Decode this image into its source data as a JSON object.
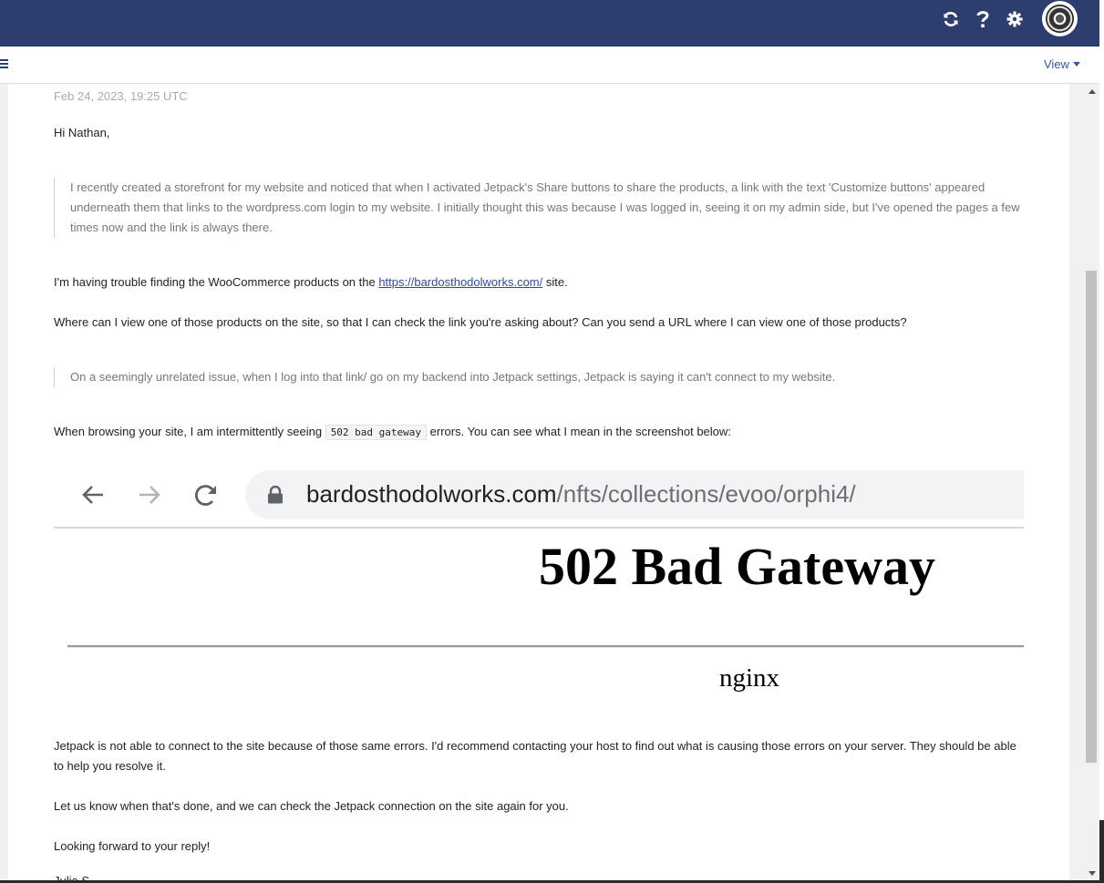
{
  "topbar": {
    "icons": [
      "refresh-icon",
      "help-icon",
      "gear-icon",
      "avatar"
    ],
    "bg_color": "#2d3e6e"
  },
  "subbar": {
    "view_label": "View"
  },
  "message": {
    "date": "Feb 24, 2023, 19:25 UTC",
    "greeting": "Hi Nathan,",
    "quote1": "I recently created a storefront for my website and noticed that when I activated Jetpack's Share buttons to share the products, a link with the text 'Customize buttons' appeared underneath them that links to the wordpress.com login to my website. I initially thought this was because I was logged in, seeing it on my admin side, but I've opened the pages a few times now and the link is always there.",
    "para1_before": "I'm having trouble finding the WooCommerce products on the ",
    "para1_link": "https://bardosthodolworks.com/",
    "para1_after": " site.",
    "para2": "Where can I view one of those products on the site, so that I can check the link you're asking about? Can you send a URL where I can view one of those products?",
    "quote2": "On a seemingly unrelated issue, when I log into that link/ go on my backend into Jetpack settings, Jetpack is saying it can't connect to my website.",
    "para3_before": "When browsing your site, I am intermittently seeing ",
    "para3_code": "502 bad gateway",
    "para3_after": " errors. You can see what I mean in the screenshot below:",
    "para4": "Jetpack is not able to connect to the site because of those same errors. I'd recommend contacting your host to find out what is causing those errors on your server. They should be able to help you resolve it.",
    "para5": "Let us know when that's done, and we can check the Jetpack connection on the site again for you.",
    "para6": "Looking forward to your reply!",
    "signature": "Julia S."
  },
  "screenshot": {
    "url_domain": "bardosthodolworks.com",
    "url_path": "/nfts/collections/evoo/orphi4/",
    "error_title": "502 Bad Gateway",
    "server_name": "nginx"
  }
}
